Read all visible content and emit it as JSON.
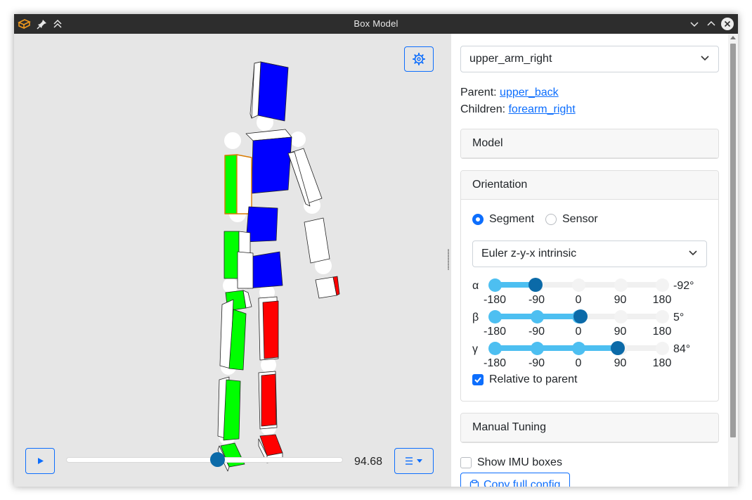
{
  "window": {
    "title": "Box Model"
  },
  "viewport": {
    "time_value": "94.68",
    "time_fraction": 0.545
  },
  "panel": {
    "segment_select": "upper_arm_right",
    "parent_label": "Parent:",
    "parent_link": "upper_back",
    "children_label": "Children:",
    "children_link": "forearm_right",
    "model_header": "Model",
    "orientation_header": "Orientation",
    "radio_segment": "Segment",
    "radio_sensor": "Sensor",
    "euler_select": "Euler z-y-x intrinsic",
    "tick_labels": [
      "-180",
      "-90",
      "0",
      "90",
      "180"
    ],
    "sliders": [
      {
        "symbol": "α",
        "value_label": "-92°",
        "value": -92
      },
      {
        "symbol": "β",
        "value_label": "5°",
        "value": 5
      },
      {
        "symbol": "γ",
        "value_label": "84°",
        "value": 84
      }
    ],
    "relative_label": "Relative to parent",
    "manual_header": "Manual Tuning",
    "show_imu_label": "Show IMU boxes",
    "copy_label": "Copy full config"
  },
  "colors": {
    "accent": "#0d6efd",
    "slider_fill": "#4dbff1",
    "thumb": "#0b6aa8",
    "box_blue": "#0000ff",
    "box_green": "#00ff00",
    "box_red": "#ff0000"
  }
}
